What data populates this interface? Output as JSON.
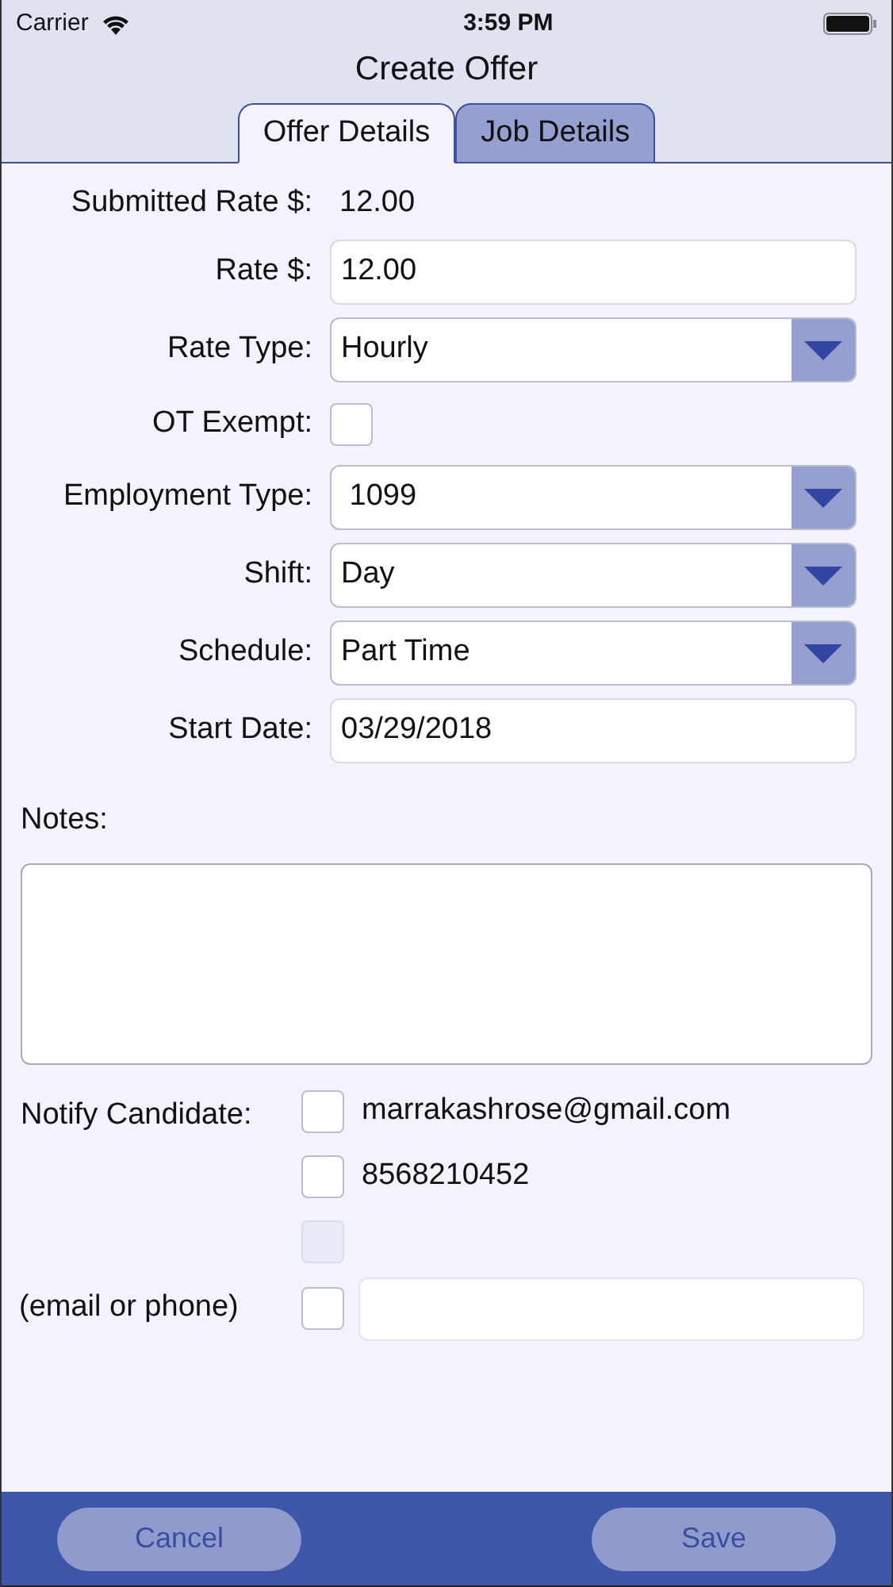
{
  "status_bar": {
    "carrier": "Carrier",
    "time": "3:59 PM"
  },
  "title": "Create Offer",
  "tabs": [
    {
      "label": "Offer Details",
      "selected": true
    },
    {
      "label": "Job Details",
      "selected": false
    }
  ],
  "fields": [
    {
      "kind": "static",
      "label": "Submitted Rate $:",
      "value": "12.00"
    },
    {
      "kind": "input",
      "label": "Rate $:",
      "value": "12.00"
    },
    {
      "kind": "select",
      "label": "Rate Type:",
      "value": "Hourly"
    },
    {
      "kind": "checkbox",
      "label": "OT Exempt:",
      "checked": false
    },
    {
      "kind": "select",
      "label": "Employment Type:",
      "value": " 1099"
    },
    {
      "kind": "select",
      "label": "Shift:",
      "value": "Day"
    },
    {
      "kind": "select",
      "label": "Schedule:",
      "value": "Part Time"
    },
    {
      "kind": "input",
      "label": "Start Date:",
      "value": "03/29/2018"
    }
  ],
  "notes": {
    "label": "Notes:"
  },
  "notify": {
    "label": "Notify Candidate:",
    "other_label": "(email or phone)",
    "options": [
      {
        "label": "marrakashrose@gmail.com",
        "checked": false,
        "disabled": false
      },
      {
        "label": "8568210452",
        "checked": false,
        "disabled": false
      },
      {
        "checked": false,
        "disabled": true
      }
    ],
    "other_checked": false
  },
  "buttons": {
    "cancel": "Cancel",
    "save": "Save"
  }
}
